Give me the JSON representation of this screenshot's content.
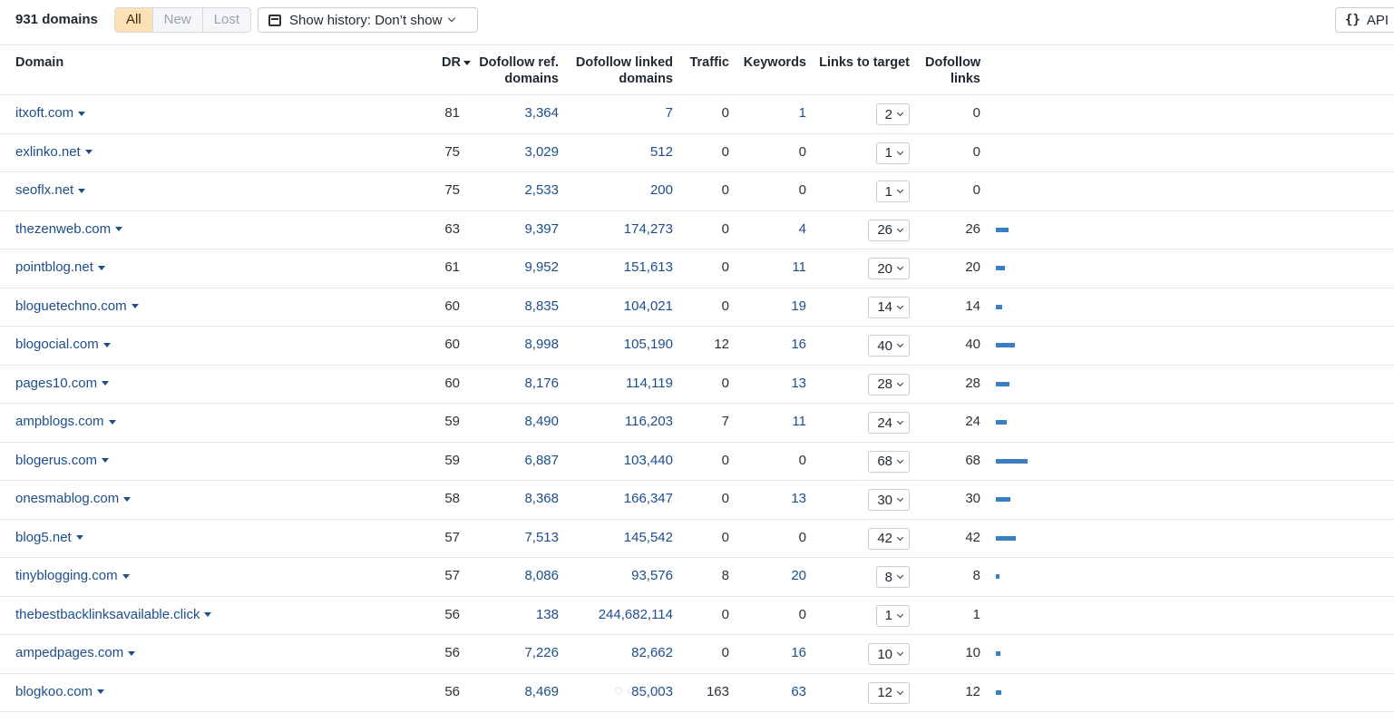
{
  "toolbar": {
    "count": "931 domains",
    "filters": [
      "All",
      "New",
      "Lost"
    ],
    "active_filter": "All",
    "history_label": "Show history: Don’t show",
    "api_label": "API",
    "icons": {
      "history": "calendar-icon",
      "api": "code-braces-icon"
    }
  },
  "columns": {
    "domain": "Domain",
    "dr": "DR",
    "dofollow_ref": [
      "Dofollow ref.",
      "domains"
    ],
    "dofollow_linked": [
      "Dofollow linked",
      "domains"
    ],
    "traffic": "Traffic",
    "keywords": "Keywords",
    "links_to_target": "Links to target",
    "dofollow_links": [
      "Dofollow",
      "links"
    ]
  },
  "rows": [
    {
      "domain": "itxoft.com",
      "dr": "81",
      "ref": "3,364",
      "linked": "7",
      "traffic": "0",
      "keywords": "1",
      "ltt": "2",
      "dofollow": "0",
      "bar": 0
    },
    {
      "domain": "exlinko.net",
      "dr": "75",
      "ref": "3,029",
      "linked": "512",
      "traffic": "0",
      "keywords": "0",
      "ltt": "1",
      "dofollow": "0",
      "bar": 0
    },
    {
      "domain": "seoflx.net",
      "dr": "75",
      "ref": "2,533",
      "linked": "200",
      "traffic": "0",
      "keywords": "0",
      "ltt": "1",
      "dofollow": "0",
      "bar": 0
    },
    {
      "domain": "thezenweb.com",
      "dr": "63",
      "ref": "9,397",
      "linked": "174,273",
      "traffic": "0",
      "keywords": "4",
      "ltt": "26",
      "dofollow": "26",
      "bar": 26
    },
    {
      "domain": "pointblog.net",
      "dr": "61",
      "ref": "9,952",
      "linked": "151,613",
      "traffic": "0",
      "keywords": "11",
      "ltt": "20",
      "dofollow": "20",
      "bar": 20
    },
    {
      "domain": "bloguetechno.com",
      "dr": "60",
      "ref": "8,835",
      "linked": "104,021",
      "traffic": "0",
      "keywords": "19",
      "ltt": "14",
      "dofollow": "14",
      "bar": 14
    },
    {
      "domain": "blogocial.com",
      "dr": "60",
      "ref": "8,998",
      "linked": "105,190",
      "traffic": "12",
      "keywords": "16",
      "ltt": "40",
      "dofollow": "40",
      "bar": 40
    },
    {
      "domain": "pages10.com",
      "dr": "60",
      "ref": "8,176",
      "linked": "114,119",
      "traffic": "0",
      "keywords": "13",
      "ltt": "28",
      "dofollow": "28",
      "bar": 28
    },
    {
      "domain": "ampblogs.com",
      "dr": "59",
      "ref": "8,490",
      "linked": "116,203",
      "traffic": "7",
      "keywords": "11",
      "ltt": "24",
      "dofollow": "24",
      "bar": 24
    },
    {
      "domain": "blogerus.com",
      "dr": "59",
      "ref": "6,887",
      "linked": "103,440",
      "traffic": "0",
      "keywords": "0",
      "ltt": "68",
      "dofollow": "68",
      "bar": 68
    },
    {
      "domain": "onesmablog.com",
      "dr": "58",
      "ref": "8,368",
      "linked": "166,347",
      "traffic": "0",
      "keywords": "13",
      "ltt": "30",
      "dofollow": "30",
      "bar": 30
    },
    {
      "domain": "blog5.net",
      "dr": "57",
      "ref": "7,513",
      "linked": "145,542",
      "traffic": "0",
      "keywords": "0",
      "ltt": "42",
      "dofollow": "42",
      "bar": 42
    },
    {
      "domain": "tinyblogging.com",
      "dr": "57",
      "ref": "8,086",
      "linked": "93,576",
      "traffic": "8",
      "keywords": "20",
      "ltt": "8",
      "dofollow": "8",
      "bar": 8
    },
    {
      "domain": "thebestbacklinksavailable.click",
      "dr": "56",
      "ref": "138",
      "linked": "244,682,114",
      "traffic": "0",
      "keywords": "0",
      "ltt": "1",
      "dofollow": "1",
      "bar": 0
    },
    {
      "domain": "ampedpages.com",
      "dr": "56",
      "ref": "7,226",
      "linked": "82,662",
      "traffic": "0",
      "keywords": "16",
      "ltt": "10",
      "dofollow": "10",
      "bar": 10
    },
    {
      "domain": "blogkoo.com",
      "dr": "56",
      "ref": "8,469",
      "linked": "85,003",
      "traffic": "163",
      "keywords": "63",
      "ltt": "12",
      "dofollow": "12",
      "bar": 12
    }
  ],
  "colors": {
    "link": "#1d4e89",
    "bar": "#3a7fc1",
    "active_filter_bg": "#fde0b3"
  }
}
